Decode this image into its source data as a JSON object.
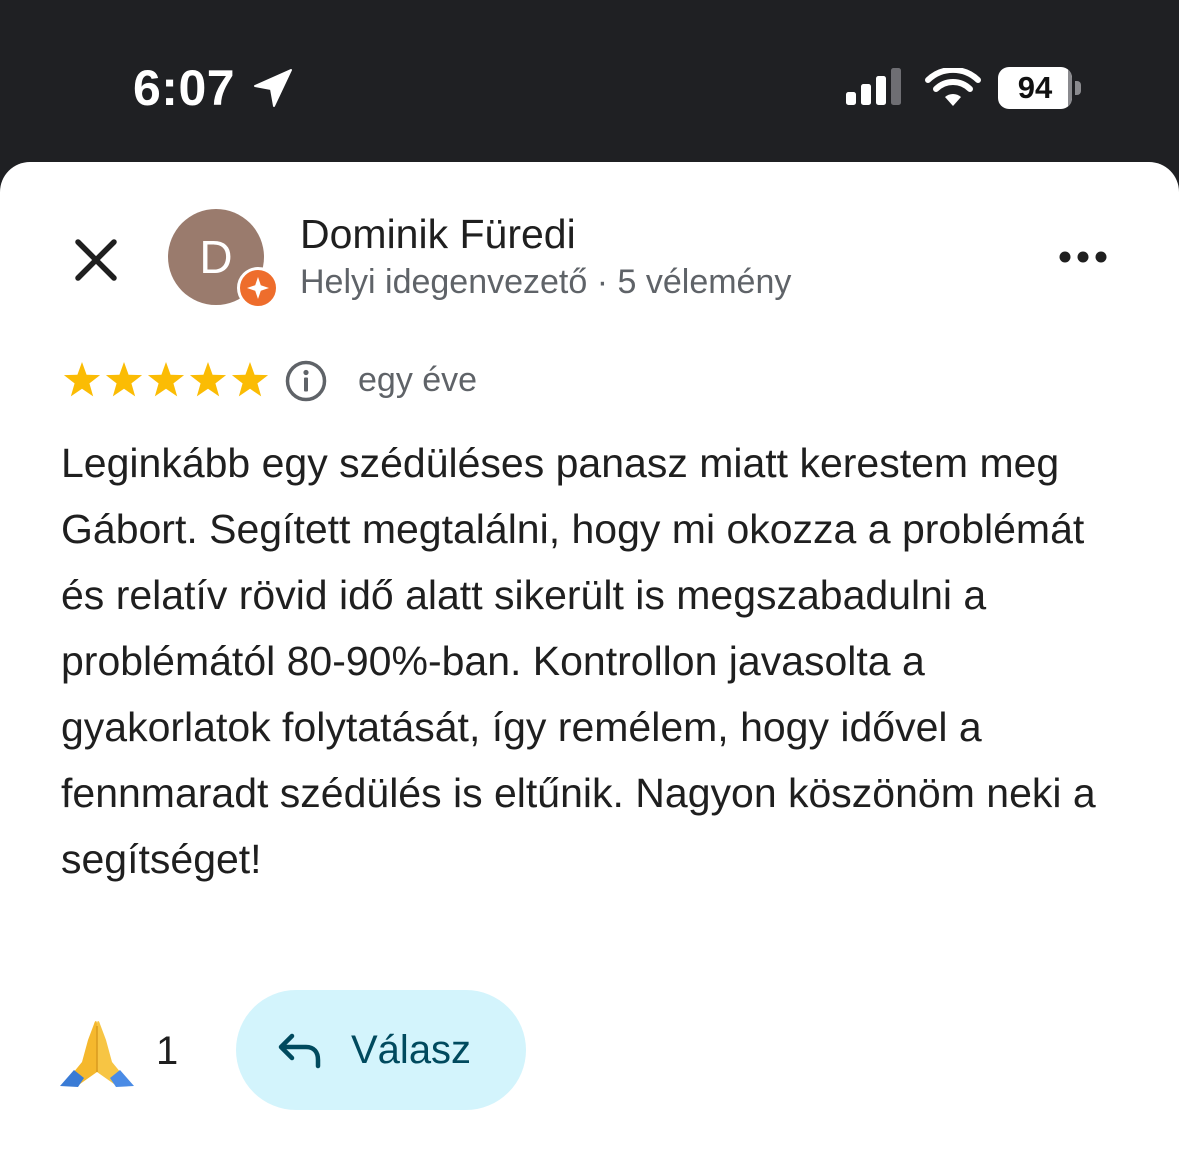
{
  "status_bar": {
    "time": "6:07",
    "battery_level": "94",
    "battery_percent": 94,
    "icons": [
      "location-arrow-icon",
      "cellular-signal-icon",
      "wifi-icon",
      "battery-icon"
    ]
  },
  "header": {
    "close_icon": "close-icon",
    "avatar_letter": "D",
    "avatar_color": "#9a7b6d",
    "badge_icon": "local-guide-badge-icon",
    "badge_color": "#ee6d2c",
    "reviewer_name": "Dominik Füredi",
    "reviewer_subtitle": "Helyi idegenvezető · 5 vélemény",
    "more_icon": "more-options-icon"
  },
  "review": {
    "rating": 5,
    "max_rating": 5,
    "star_color": "#fbbc04",
    "info_icon": "info-icon",
    "time": "egy éve",
    "text": "Leginkább egy szédüléses panasz miatt kerestem meg Gábort. Segített megtalálni, hogy mi okozza a problémát és relatív rövid idő alatt sikerült is megszabadulni a problémától 80-90%-ban. Kontrollon javasolta a gyakorlatok folytatását, így remélem, hogy idővel a fennmaradt szédülés is eltűnik. Nagyon köszönöm neki a segítséget!"
  },
  "actions": {
    "reaction_emoji": "🙏",
    "reaction_count": "1",
    "reply_icon": "reply-arrow-icon",
    "reply_label": "Válasz",
    "reply_bg_color": "#d3f4fc",
    "reply_text_color": "#004a5e"
  }
}
